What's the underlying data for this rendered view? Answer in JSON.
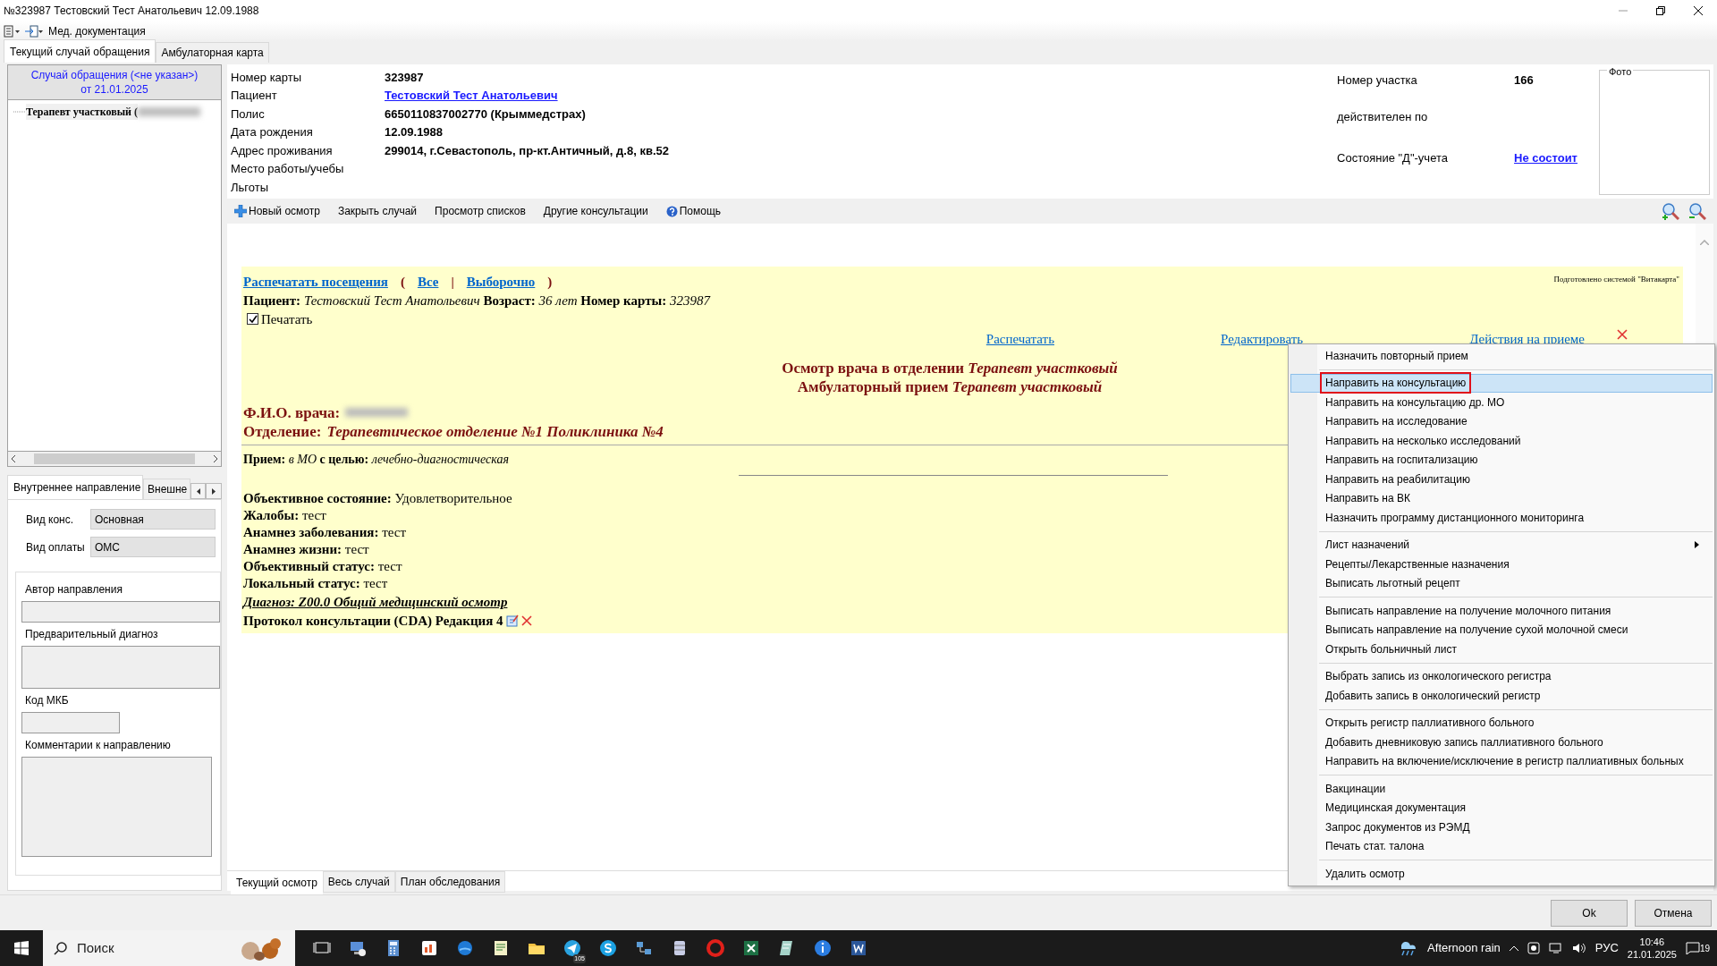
{
  "window": {
    "title": "№323987 Тестовский Тест Анатольевич 12.09.1988"
  },
  "toolbar": {
    "menu_label": "Мед. документация"
  },
  "tabs": [
    {
      "label": "Текущий случай обращения",
      "selected": true
    },
    {
      "label": "Амбулаторная карта",
      "selected": false
    }
  ],
  "case_panel": {
    "header": [
      "Случай обращения (<не указан>)",
      "от 21.01.2025"
    ],
    "tree": [
      {
        "label": "Терапевт участковый ("
      }
    ]
  },
  "referral_tabs": [
    {
      "label": "Внутреннее направление",
      "selected": true
    },
    {
      "label": "Внешне",
      "selected": false
    }
  ],
  "referral_form": {
    "fields": [
      {
        "label": "Вид конс.",
        "value": "Основная"
      },
      {
        "label": "Вид оплаты",
        "value": "ОМС"
      }
    ],
    "groups": [
      {
        "label": "Автор направления",
        "kind": "line"
      },
      {
        "label": "Предварительный диагноз",
        "kind": "area"
      },
      {
        "label": "Код МКБ",
        "kind": "short"
      },
      {
        "label": "Комментарии к направлению",
        "kind": "memo"
      }
    ]
  },
  "patient_info": {
    "left": [
      {
        "label": "Номер карты",
        "value": "323987",
        "kind": "text"
      },
      {
        "label": "Пациент",
        "value": "Тестовский Тест Анатольевич",
        "kind": "link"
      },
      {
        "label": "Полис",
        "value": "6650110837002770 (Крыммедстрах)",
        "kind": "text"
      },
      {
        "label": "Дата рождения",
        "value": "12.09.1988",
        "kind": "text"
      },
      {
        "label": "Адрес проживания",
        "value": "299014, г.Севастополь, пр-кт.Античный, д.8, кв.52",
        "kind": "text"
      },
      {
        "label": "Место работы/учебы"
      },
      {
        "label": "Льготы"
      }
    ],
    "right": [
      {
        "label": "Номер участка",
        "value": "166",
        "kind": "text"
      },
      {
        "label": "действителен по"
      },
      {
        "label": "Состояние \"Д\"-учета",
        "value": "Не состоит",
        "kind": "link"
      }
    ],
    "photo_label": "Фото"
  },
  "actions": [
    {
      "label": "Новый осмотр",
      "kind": "plus"
    },
    {
      "label": "Закрыть случай",
      "kind": "plain"
    },
    {
      "label": "Просмотр списков",
      "kind": "plain"
    },
    {
      "label": "Другие консультации",
      "kind": "plain"
    },
    {
      "label": "Помощь",
      "kind": "help"
    }
  ],
  "document": {
    "print_row": [
      {
        "text": "Распечатать посещения",
        "kind": "link"
      },
      {
        "text": "(",
        "kind": "punct"
      },
      {
        "text": "Все",
        "kind": "link"
      },
      {
        "text": "|",
        "kind": "punct"
      },
      {
        "text": "Выборочно",
        "kind": "link"
      },
      {
        "text": ")",
        "kind": "punct"
      }
    ],
    "system_note": "Подготовлено системой \"Витакарта\"",
    "patient_line": "**Пациент:** *Тестовский Тест Анатольевич* **Возраст:** *36 лет* **Номер карты:** *323987*",
    "print_checkbox": {
      "label": "Печатать",
      "checked": true
    },
    "links": [
      "Распечатать",
      "Редактировать",
      "Действия на приеме"
    ],
    "titles": [
      "Осмотр врача в отделении *Терапевт участковый*",
      "Амбулаторный прием *Терапевт участковый*"
    ],
    "doctor_label": "Ф.И.О. врача:",
    "department": "Отделение: *Терапевтическое отделение №1 Поликлиника №4*",
    "reception": "**Прием:** *в МО* **с целью:** *лечебно-диагностическая*",
    "findings": [
      "**Объективное состояние:** Удовлетворительное",
      "**Жалобы:** тест",
      "**Анамнез заболевания:** тест",
      "**Анамнез жизни:** тест",
      "**Объективный статус:** тест",
      "**Локальный статус:** тест"
    ],
    "diagnosis": "Диагноз: Z00.0 Общий медицинский осмотр",
    "protocol": "Протокол консультации (CDA) Редакция 4"
  },
  "bottom_tabs": [
    {
      "label": "Текущий осмотр",
      "selected": true
    },
    {
      "label": "Весь случай",
      "selected": false
    },
    {
      "label": "План обследования",
      "selected": false
    }
  ],
  "buttons": [
    "Ok",
    "Отмена"
  ],
  "context_menu": {
    "groups": [
      [
        {
          "label": "Назначить повторный прием",
          "selected": false,
          "annotated": false,
          "submenu": false
        }
      ],
      [
        {
          "label": "Направить на консультацию",
          "selected": true,
          "annotated": true,
          "submenu": false
        },
        {
          "label": "Направить на консультацию др. МО",
          "selected": false,
          "annotated": false,
          "submenu": false
        },
        {
          "label": "Направить на исследование",
          "selected": false,
          "annotated": false,
          "submenu": false
        },
        {
          "label": "Направить на несколько исследований",
          "selected": false,
          "annotated": false,
          "submenu": false
        },
        {
          "label": "Направить на госпитализацию",
          "selected": false,
          "annotated": false,
          "submenu": false
        },
        {
          "label": "Направить на реабилитацию",
          "selected": false,
          "annotated": false,
          "submenu": false
        },
        {
          "label": "Направить на ВК",
          "selected": false,
          "annotated": false,
          "submenu": false
        },
        {
          "label": "Назначить программу дистанционного мониторинга",
          "selected": false,
          "annotated": false,
          "submenu": false
        }
      ],
      [
        {
          "label": "Лист назначений",
          "selected": false,
          "annotated": false,
          "submenu": true
        },
        {
          "label": "Рецепты/Лекарственные назначения",
          "selected": false,
          "annotated": false,
          "submenu": false
        },
        {
          "label": "Выписать льготный рецепт",
          "selected": false,
          "annotated": false,
          "submenu": false
        }
      ],
      [
        {
          "label": "Выписать направление на получение молочного питания",
          "selected": false,
          "annotated": false,
          "submenu": false
        },
        {
          "label": "Выписать направление на получение сухой молочной смеси",
          "selected": false,
          "annotated": false,
          "submenu": false
        },
        {
          "label": "Открыть больничный лист",
          "selected": false,
          "annotated": false,
          "submenu": false
        }
      ],
      [
        {
          "label": "Выбрать запись из онкологического регистра",
          "selected": false,
          "annotated": false,
          "submenu": false
        },
        {
          "label": "Добавить запись в онкологический регистр",
          "selected": false,
          "annotated": false,
          "submenu": false
        }
      ],
      [
        {
          "label": "Открыть регистр паллиативного больного",
          "selected": false,
          "annotated": false,
          "submenu": false
        },
        {
          "label": "Добавить дневниковую запись паллиативного больного",
          "selected": false,
          "annotated": false,
          "submenu": false
        },
        {
          "label": "Направить на включение/исключение в регистр паллиативных больных",
          "selected": false,
          "annotated": false,
          "submenu": false
        }
      ],
      [
        {
          "label": "Вакцинации",
          "selected": false,
          "annotated": false,
          "submenu": false
        },
        {
          "label": "Медицинская документация",
          "selected": false,
          "annotated": false,
          "submenu": false
        },
        {
          "label": "Запрос документов из РЭМД",
          "selected": false,
          "annotated": false,
          "submenu": false
        },
        {
          "label": "Печать стат. талона",
          "selected": false,
          "annotated": false,
          "submenu": false
        }
      ],
      [
        {
          "label": "Удалить осмотр",
          "selected": false,
          "annotated": false,
          "submenu": false
        }
      ]
    ]
  },
  "taskbar": {
    "search_placeholder": "Поиск",
    "telegram_badge": "105",
    "weather": "Afternoon rain",
    "language": "РУС",
    "time": "10:46",
    "date": "21.01.2025",
    "notifications": "19"
  }
}
